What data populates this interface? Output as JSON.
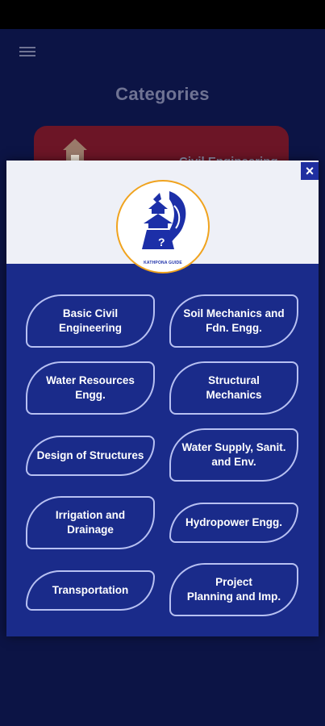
{
  "screen": {
    "title": "Categories",
    "background_card_label": "Civil Engineering"
  },
  "modal": {
    "close_label": "×",
    "logo_caption": "KATHPONA GUIDE",
    "categories": [
      {
        "label": "Basic Civil\nEngineering"
      },
      {
        "label": "Soil Mechanics and\nFdn. Engg."
      },
      {
        "label": "Water Resources\nEngg."
      },
      {
        "label": "Structural\nMechanics"
      },
      {
        "label": "Design of Structures"
      },
      {
        "label": "Water Supply, Sanit.\nand Env."
      },
      {
        "label": "Irrigation and\nDrainage"
      },
      {
        "label": "Hydropower Engg."
      },
      {
        "label": "Transportation"
      },
      {
        "label": "Project\nPlanning and Imp."
      }
    ]
  },
  "colors": {
    "modal_background": "#1a2b8a",
    "button_border": "#b7c0f2",
    "logo_blue": "#1c2fa8",
    "logo_ring": "#f0a31e"
  }
}
